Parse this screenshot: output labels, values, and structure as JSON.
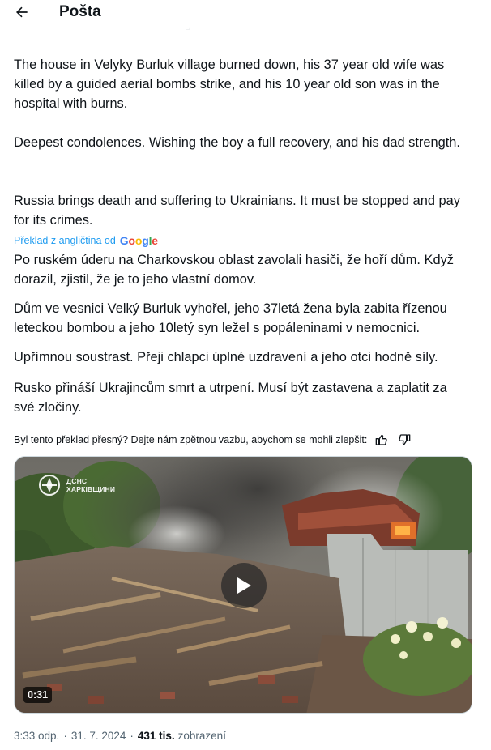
{
  "header": {
    "title": "Pošta",
    "back_icon": "arrow-left-icon"
  },
  "post": {
    "original_paragraphs": [
      "The house in Velyky Burluk village burned down, his 37 year old wife was killed by a guided aerial bombs strike, and his 10 year old son was in the hospital with burns.",
      "Deepest condolences. Wishing the boy a full recovery, and his dad strength.",
      "Russia brings death and suffering to Ukrainians. It must be stopped and pay for its crimes."
    ],
    "translation_label": "Překlad z angličtina od",
    "translation_provider": "Google",
    "translated_paragraphs": [
      "Po ruském úderu na Charkovskou oblast zavolali hasiči, že hoří dům. Když dorazil, zjistil, že je to jeho vlastní domov.",
      "Dům ve vesnici Velký Burluk vyhořel, jeho 37letá žena byla zabita řízenou leteckou bombou a jeho 10letý syn ležel s popáleninami v nemocnici.",
      "Upřímnou soustrast. Přeji chlapci úplné uzdravení a jeho otci hodně síly.",
      "Rusko přináší Ukrajincům smrt a utrpení. Musí být zastavena a zaplatit za své zločiny."
    ],
    "feedback_prompt": "Byl tento překlad přesný? Dejte nám zpětnou vazbu, abychom se mohli zlepšit:",
    "feedback_icons": [
      "thumbs-up-icon",
      "thumbs-down-icon"
    ]
  },
  "video": {
    "watermark_line1": "ДСНС",
    "watermark_line2": "ХАРКІВЩИНИ",
    "duration": "0:31",
    "play_icon": "play-icon"
  },
  "meta": {
    "time": "3:33 odp.",
    "date": "31. 7. 2024",
    "separator": "·",
    "views_count": "431 tis.",
    "views_label": "zobrazení"
  },
  "colors": {
    "link": "#1d9bf0",
    "text": "#0f1419",
    "secondary": "#536471"
  }
}
